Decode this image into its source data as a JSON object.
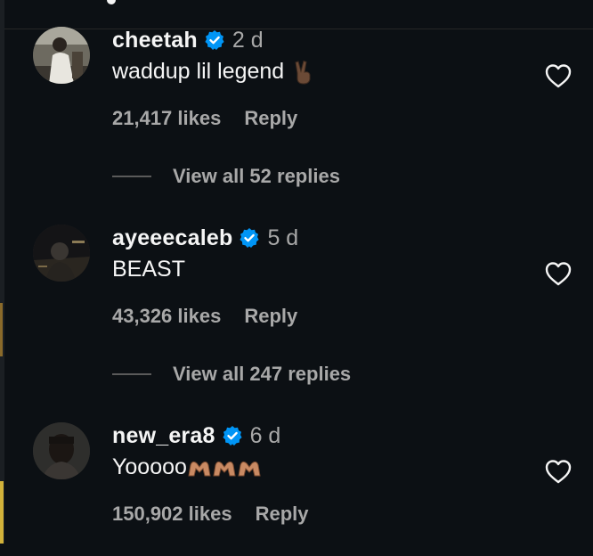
{
  "colors": {
    "background": "#0c1014",
    "verified": "#0095f6",
    "secondary_text": "#a8a8a8",
    "primary_text": "#f5f5f5"
  },
  "comments": [
    {
      "username": "cheetah",
      "time": "2 d",
      "text": "waddup lil legend",
      "emoji": "victory-hand-icon",
      "likes": "21,417 likes",
      "reply_label": "Reply",
      "view_replies": "View all 52 replies"
    },
    {
      "username": "ayeeecaleb",
      "time": "5 d",
      "text": "BEAST",
      "likes": "43,326 likes",
      "reply_label": "Reply",
      "view_replies": "View all 247 replies"
    },
    {
      "username": "new_era8",
      "time": "6 d",
      "text": "Yooooo",
      "emoji": "heart-hands-icon",
      "likes": "150,902 likes",
      "reply_label": "Reply"
    }
  ]
}
